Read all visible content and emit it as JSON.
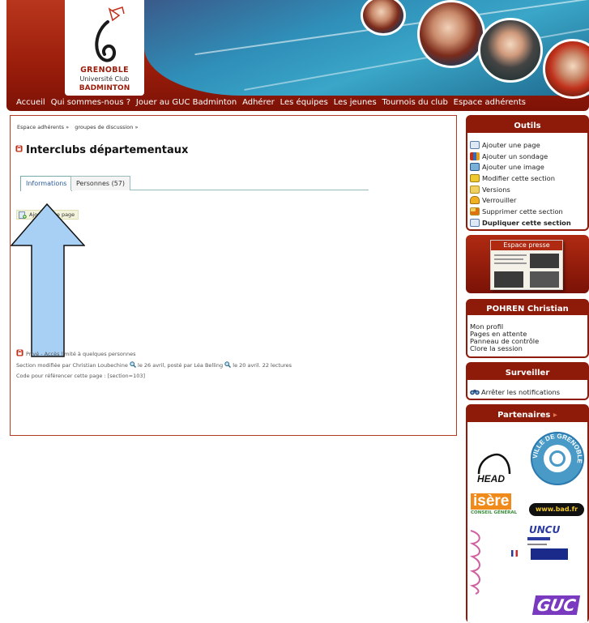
{
  "header": {
    "logo": {
      "line1": "GRENOBLE",
      "line2": "Université Club",
      "line3": "BADMINTON"
    },
    "nav": [
      "Accueil",
      "Qui sommes-nous ?",
      "Jouer au GUC Badminton",
      "Adhérer",
      "Les équipes",
      "Les jeunes",
      "Tournois du club",
      "Espace adhérents"
    ]
  },
  "main": {
    "breadcrumb": [
      "Espace adhérents »",
      "groupes de discussion »"
    ],
    "title": "Interclubs départementaux",
    "tabs": [
      {
        "label": "Informations",
        "active": true
      },
      {
        "label": "Personnes (57)",
        "active": false
      }
    ],
    "add_page_button": "Ajouter une page",
    "meta": {
      "privacy": "Privé - Accès limité à quelques personnes",
      "modified": "Section modifiée par Christian Loubechine",
      "modified_date": "le 26 avril, posté par Léa Belling",
      "posted_date": "le 20 avril. 22 lectures",
      "reference": "Code pour référencer cette page : [section=103]"
    }
  },
  "sidebar": {
    "tools": {
      "title": "Outils",
      "items": [
        {
          "label": "Ajouter une page",
          "icon": "add-page-icon",
          "bold": false
        },
        {
          "label": "Ajouter un sondage",
          "icon": "add-poll-icon",
          "bold": false
        },
        {
          "label": "Ajouter une image",
          "icon": "add-image-icon",
          "bold": false
        },
        {
          "label": "Modifier cette section",
          "icon": "edit-icon",
          "bold": false
        },
        {
          "label": "Versions",
          "icon": "versions-icon",
          "bold": false
        },
        {
          "label": "Verrouiller",
          "icon": "lock-icon",
          "bold": false
        },
        {
          "label": "Supprimer cette section",
          "icon": "delete-icon",
          "bold": false
        },
        {
          "label": "Dupliquer cette section",
          "icon": "duplicate-icon",
          "bold": true
        }
      ]
    },
    "press": {
      "title": "Espace presse"
    },
    "profile": {
      "name": "POHREN Christian",
      "links": [
        "Mon profil",
        "Pages en attente",
        "Panneau de contrôle",
        "Clore la session"
      ]
    },
    "watch": {
      "title": "Surveiller",
      "action": "Arrêter les notifications"
    },
    "partners": {
      "title": "Partenaires",
      "logos": [
        "HEAD",
        "VILLE DE GRENOBLE",
        "isère",
        "CONSEIL GÉNÉRAL",
        "www.bad.fr",
        "UNCU",
        "GUC"
      ]
    }
  },
  "colors": {
    "brand_red": "#9a1d0b",
    "frame": "#b43a22",
    "arrow_fill": "#a8cff4"
  }
}
